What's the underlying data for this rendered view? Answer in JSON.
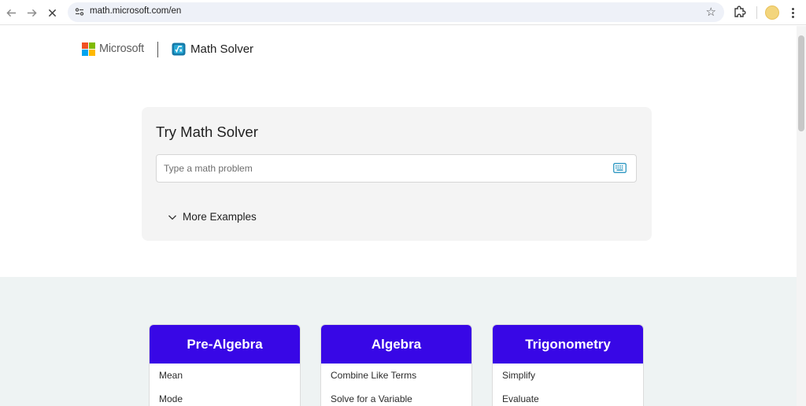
{
  "browser": {
    "url": "math.microsoft.com/en",
    "back_icon": "arrow-left",
    "forward_icon": "arrow-right",
    "stop_icon": "close",
    "bookmark_icon": "star-outline",
    "extensions_icon": "puzzle",
    "menu_icon": "kebab-vertical"
  },
  "header": {
    "company": "Microsoft",
    "product": "Math Solver",
    "logo_colors": [
      "#f25022",
      "#7fba00",
      "#00a4ef",
      "#ffb900"
    ]
  },
  "solver": {
    "title": "Try Math Solver",
    "input_placeholder": "Type a math problem",
    "input_value": "",
    "more_examples": "More Examples"
  },
  "categories": [
    {
      "title": "Pre-Algebra",
      "items": [
        "Mean",
        "Mode"
      ]
    },
    {
      "title": "Algebra",
      "items": [
        "Combine Like Terms",
        "Solve for a Variable"
      ]
    },
    {
      "title": "Trigonometry",
      "items": [
        "Simplify",
        "Evaluate"
      ]
    }
  ],
  "colors": {
    "category_header": "#3807e6",
    "lower_bg": "#eef3f3",
    "card_bg": "#f4f4f4"
  }
}
